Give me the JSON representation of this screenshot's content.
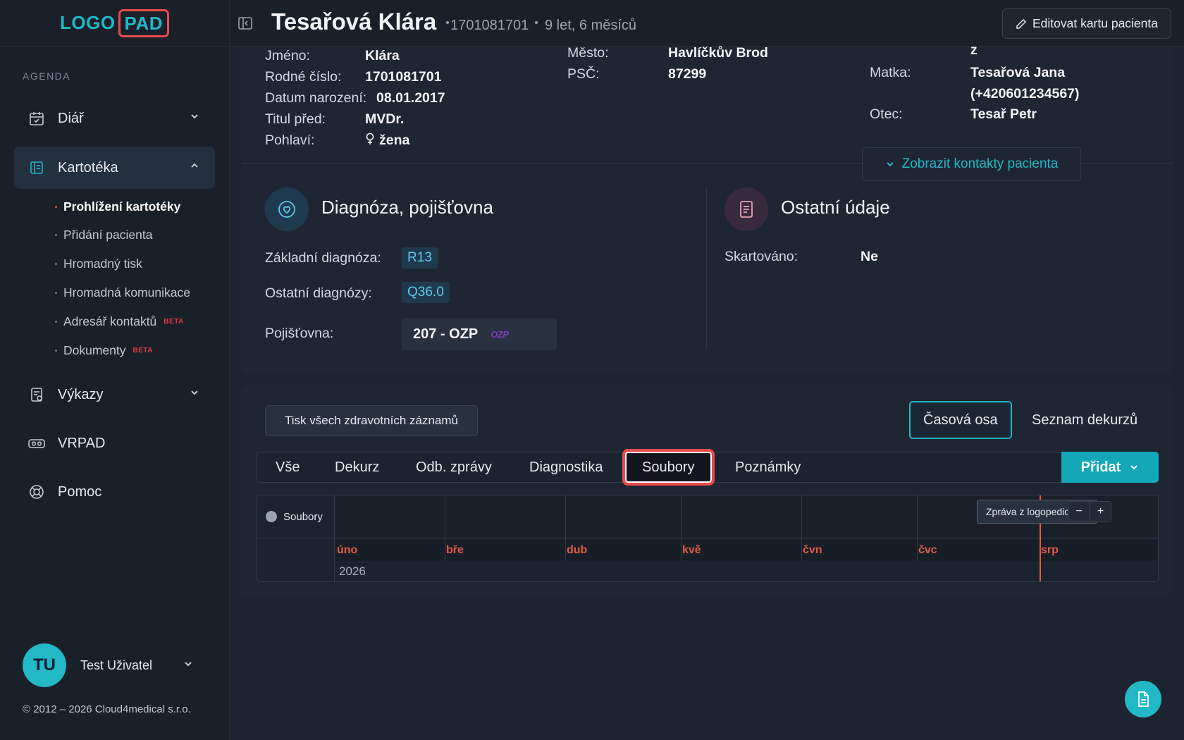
{
  "logo": {
    "part1": "LOGO",
    "part2": "PAD"
  },
  "sidebar": {
    "section_label": "AGENDA",
    "items": [
      {
        "label": "Diář",
        "icon": "calendar-icon"
      },
      {
        "label": "Kartotéka",
        "icon": "card-file-icon"
      },
      {
        "label": "Výkazy",
        "icon": "report-icon"
      },
      {
        "label": "VRPAD",
        "icon": "vr-headset-icon"
      },
      {
        "label": "Pomoc",
        "icon": "lifebuoy-icon"
      }
    ],
    "sub_items": [
      {
        "label": "Prohlížení kartotéky"
      },
      {
        "label": "Přidání pacienta"
      },
      {
        "label": "Hromadný tisk"
      },
      {
        "label": "Hromadná komunikace"
      },
      {
        "label": "Adresář kontaktů",
        "badge": "BETA"
      },
      {
        "label": "Dokumenty",
        "badge": "BETA"
      }
    ],
    "user": {
      "initials": "TU",
      "name": "Test Uživatel"
    },
    "copyright": "© 2012 – 2026 Cloud4medical s.r.o."
  },
  "header": {
    "patient_name": "Tesařová Klára",
    "patient_id": "1701081701",
    "age": "9 let, 6 měsíců",
    "edit_label": "Editovat kartu pacienta"
  },
  "patient": {
    "first_name_label": "Jméno:",
    "first_name": "Klára",
    "birth_number_label": "Rodné číslo:",
    "birth_number": "1701081701",
    "birth_date_label": "Datum narození:",
    "birth_date": "08.01.2017",
    "title_label": "Titul před:",
    "title": "MVDr.",
    "gender_label": "Pohlaví:",
    "gender": "žena",
    "city_label": "Město:",
    "city": "Havlíčkův Brod",
    "zip_label": "PSČ:",
    "zip": "87299",
    "top_right_value": "z",
    "mother_label": "Matka:",
    "mother": "Tesařová Jana",
    "mother_phone": "(+420601234567)",
    "father_label": "Otec:",
    "father": "Tesař Petr",
    "contacts_button": "Zobrazit kontakty pacienta"
  },
  "diagnosis": {
    "title": "Diagnóza, pojišťovna",
    "main_label": "Základní diagnóza:",
    "main_value": "R13",
    "other_label": "Ostatní diagnózy:",
    "other_value": "Q36.0",
    "insurance_label": "Pojišťovna:",
    "insurance_value": "207 - OZP",
    "insurance_logo": "OZP"
  },
  "other": {
    "title": "Ostatní údaje",
    "shredded_label": "Skartováno:",
    "shredded_value": "Ne"
  },
  "records": {
    "print_all": "Tisk všech zdravotních záznamů",
    "view_timeline": "Časová osa",
    "view_list": "Seznam dekurzů",
    "tabs": [
      "Vše",
      "Dekurz",
      "Odb. zprávy",
      "Diagnostika",
      "Soubory",
      "Poznámky"
    ],
    "active_tab": "Soubory",
    "add_label": "Přidat"
  },
  "timeline": {
    "row_label": "Soubory",
    "months": [
      "úno",
      "bře",
      "dub",
      "kvě",
      "čvn",
      "čvc",
      "srp"
    ],
    "year": "2026",
    "event": "Zpráva z logopedické...",
    "zoom_out": "−",
    "zoom_in": "+"
  },
  "colors": {
    "accent": "#22b8c6",
    "highlight": "#e74c4c",
    "month": "#e55a45"
  }
}
